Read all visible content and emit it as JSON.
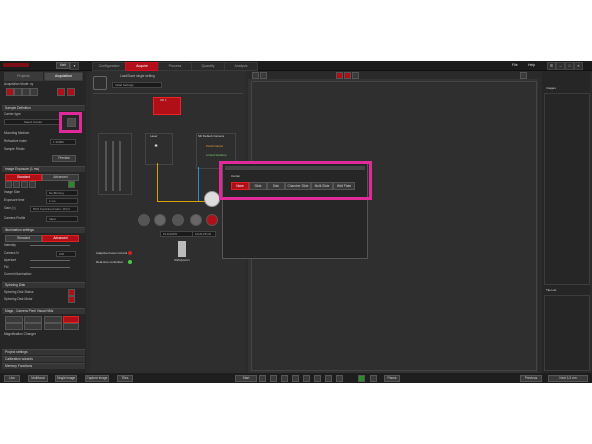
{
  "app": {
    "user_label": "Matt",
    "main_tabs": [
      "Configuration",
      "Acquire",
      "Process",
      "Quantify",
      "Analysis"
    ],
    "active_tab": "Acquire",
    "menu": [
      "File",
      "Help"
    ]
  },
  "left_panel": {
    "tabs": [
      "Projects",
      "Acquisition"
    ],
    "acq_mode_label": "Acquisition Mode: xy",
    "sample_section": "Sample Definition",
    "carrier_type_label": "Carrier type",
    "carrier_select_placeholder": "Select Carrier",
    "mounting_medium_label": "Mounting Medium",
    "refractive_index_label": "Refractive index",
    "refractive_index_value": "1.33000",
    "sample_finder_label": "Sample Finder",
    "preview_button": "Preview",
    "image_exposure_section": "Image Exposure (1 ms)",
    "standard_tab": "Standard",
    "advanced_tab": "Advanced",
    "image_size_label": "Image Size",
    "image_size_value": "No Binning",
    "exposure_label": "Exposure time",
    "exposure_value": "1 ms",
    "gain_label": "Gain (=)",
    "gain_value": "50% Combined Gain: 16 bit",
    "camera_profile_label": "Camera Profile",
    "camera_profile_value": "Ideal",
    "illumination_section": "Illumination settings",
    "illum_standard": "Standard",
    "illum_advanced": "Advanced",
    "intensity_label": "Intensity",
    "camera_n_label": "Camera N",
    "camera_n_value": "100",
    "aperture_label": "Aperture",
    "fld_label": "Fld",
    "current_illum_label": "Current illumination",
    "spinning_disk_section": "Spinning Disk",
    "spinning_status_label": "Spinning Disk Status",
    "spinning_motor_label": "Spinning Disk Motor",
    "magnif_section": "Magn., Camera Pixel Visual NMs",
    "magnif_changer_label": "Magnification Changer",
    "project_settings": "Project settings",
    "calibration_wizards": "Calibration wizards",
    "memory_functions": "Memory Functions"
  },
  "center": {
    "load_setting_label": "Load/Save single setting",
    "setting_value": "Initial Settings",
    "channel_label": "SD 1",
    "laser_label": "Laser",
    "camera_label": "SD Default Camera",
    "performance_label": "Performance",
    "linked_hardware_label": "Linked Desktop",
    "objective_label": "Objective/Analysis",
    "obj_value": "PLANAPO",
    "obj_tag": "Obj",
    "obj_mag": "10x/0.25 Oil",
    "oil_label": "Oil/Glycerin",
    "adaptive_focus_label": "Adaptive Focus Control",
    "realtime_label": "Real-time controlled"
  },
  "carrier_popup": {
    "title": "Carrier",
    "options": [
      "None",
      "Slide",
      "Dish",
      "Chamber Slide",
      "Multi Slide",
      "Well Plate"
    ],
    "selected": "None"
  },
  "right_panel": {
    "images_label": "Images",
    "tile_list_label": "Tile List"
  },
  "bottom": {
    "left_buttons": [
      "Live",
      "Multifocal",
      "Single image",
      "Capture image",
      "Tiles"
    ],
    "start_label": "Start",
    "pause_label": "Pause",
    "right_buttons": [
      "Previous",
      "Next 1/1 nm"
    ]
  },
  "colors": {
    "accent": "#b30f1a",
    "highlight": "#e02a9a",
    "dark_bg": "#2b2b2b"
  }
}
